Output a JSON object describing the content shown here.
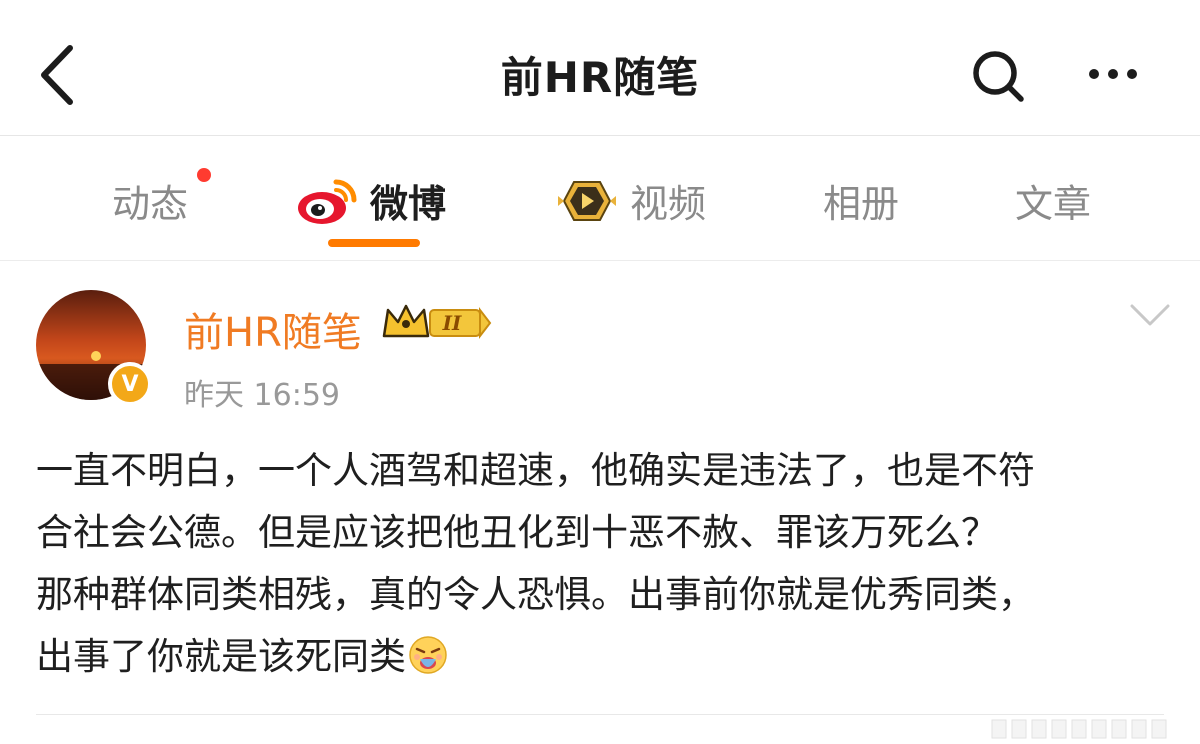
{
  "header": {
    "title": "前HR随笔"
  },
  "tabs": [
    {
      "label": "动态",
      "has_dot": true
    },
    {
      "label": "微博",
      "active": true
    },
    {
      "label": "视频"
    },
    {
      "label": "相册"
    },
    {
      "label": "文章"
    }
  ],
  "post": {
    "author": "前HR随笔",
    "level_badge": "II",
    "verified_badge": "V",
    "time": "昨天 16:59",
    "lines": [
      "一直不明白，一个人酒驾和超速，他确实是违法了，也是不符",
      "合社会公德。但是应该把他丑化到十恶不赦、罪该万死么？",
      "那种群体同类相残，真的令人恐惧。出事前你就是优秀同类，",
      "出事了你就是该死同类"
    ]
  },
  "colors": {
    "accent": "#ff7a00",
    "author": "#f07b23",
    "dot": "#ff3b30",
    "verify": "#f3a818"
  },
  "icons": [
    "back-icon",
    "search-icon",
    "more-icon",
    "weibo-logo-icon",
    "video-logo-icon",
    "avatar-sunset",
    "crown-level-icon",
    "chevron-down-icon",
    "emoji-icon"
  ]
}
